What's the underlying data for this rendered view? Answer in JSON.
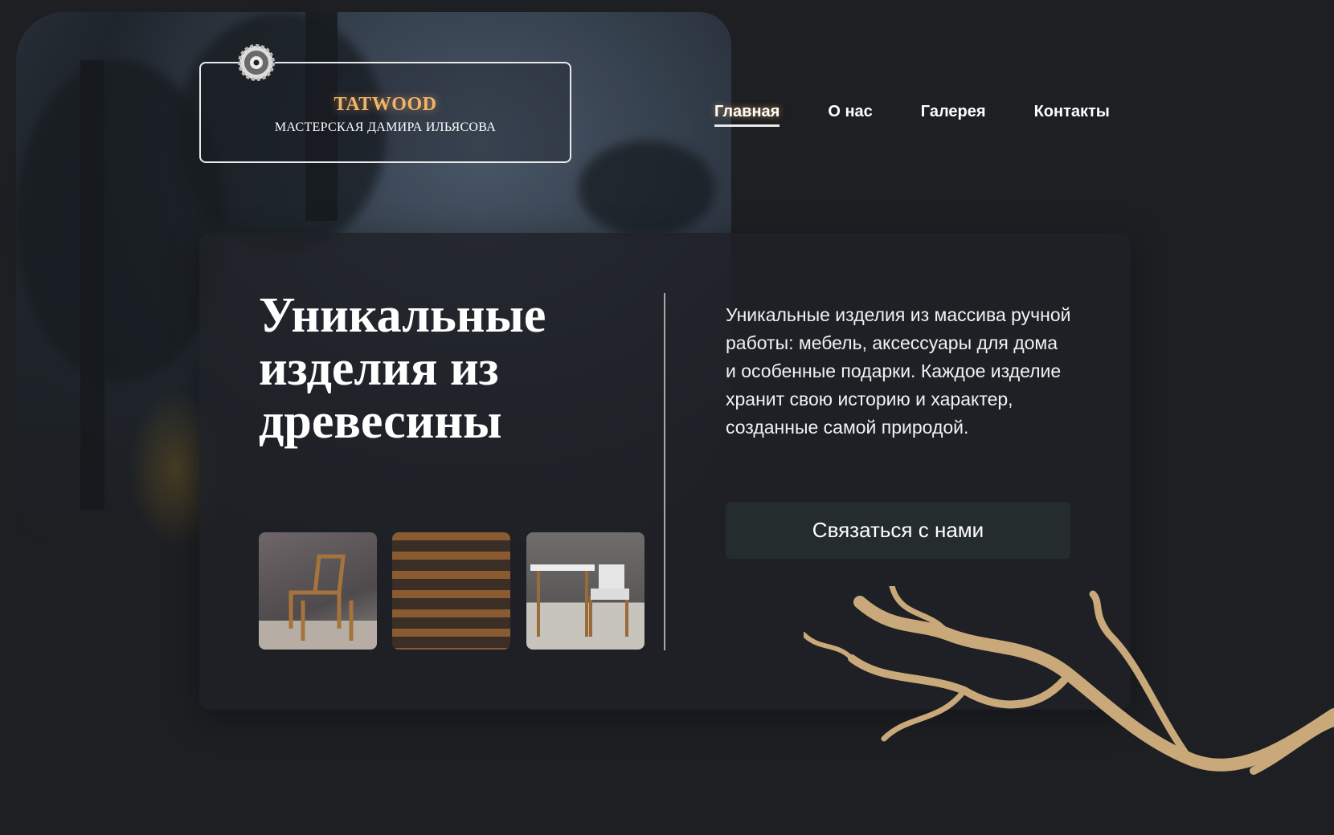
{
  "logo": {
    "brand": "TATWOOD",
    "subtitle": "МАСТЕРСКАЯ ДАМИРА ИЛЬЯСОВА",
    "icon": "saw-blade-icon"
  },
  "nav": {
    "items": [
      {
        "label": "Главная",
        "active": true
      },
      {
        "label": "О нас"
      },
      {
        "label": "Галерея"
      },
      {
        "label": "Контакты"
      }
    ]
  },
  "hero": {
    "title": "Уникальные изделия из древесины",
    "description": "Уникальные изделия из массива ручной работы: мебель, аксессуары для дома и особенные подарки. Каждое изделие хранит свою историю и характер, созданные самой природой.",
    "cta": "Связаться с нами"
  },
  "colors": {
    "accent": "#f0b46a",
    "background": "#1d1f23",
    "button": "#252c2e"
  }
}
